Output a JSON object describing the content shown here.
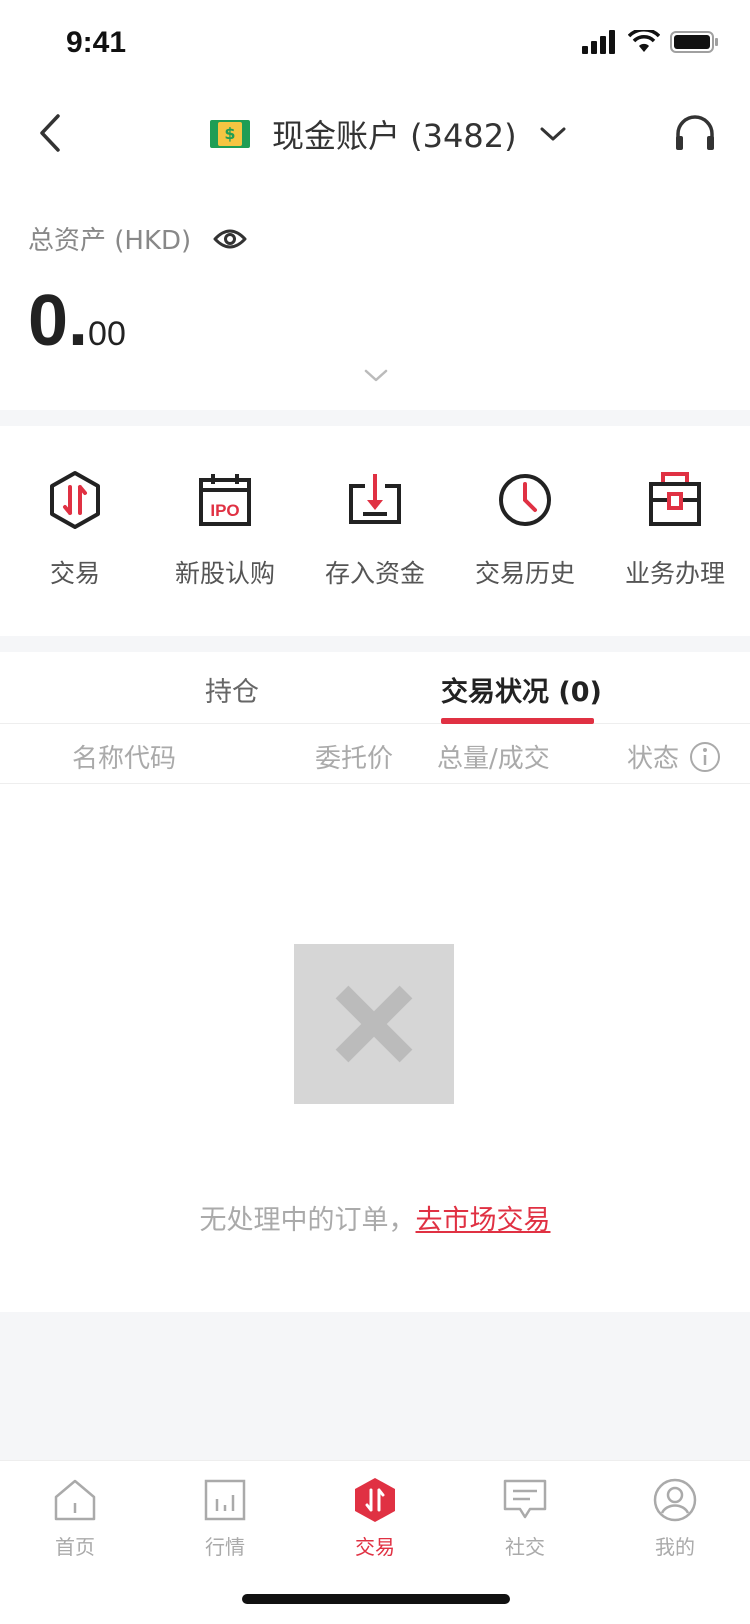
{
  "status": {
    "time": "9:41"
  },
  "nav": {
    "account_label": "现金账户 (3482)"
  },
  "assets": {
    "label": "总资产 (HKD)",
    "value_int": "0.",
    "value_dec": "00"
  },
  "quick_actions": [
    {
      "label": "交易",
      "icon": "trade-hexagon-icon"
    },
    {
      "label": "新股认购",
      "icon": "ipo-calendar-icon"
    },
    {
      "label": "存入资金",
      "icon": "deposit-icon"
    },
    {
      "label": "交易历史",
      "icon": "clock-icon"
    },
    {
      "label": "业务办理",
      "icon": "briefcase-icon"
    }
  ],
  "tabs": {
    "holdings": "持仓",
    "orders": "交易状况 (0)"
  },
  "table_header": {
    "name": "名称代码",
    "price": "委托价",
    "qty": "总量/成交",
    "status": "状态"
  },
  "empty": {
    "text": "无处理中的订单，",
    "link": "去市场交易"
  },
  "tab_bar": [
    {
      "label": "首页",
      "icon": "home-icon"
    },
    {
      "label": "行情",
      "icon": "market-chart-icon"
    },
    {
      "label": "交易",
      "icon": "trade-hexagon-icon",
      "active": true
    },
    {
      "label": "社交",
      "icon": "chat-icon"
    },
    {
      "label": "我的",
      "icon": "profile-icon"
    }
  ],
  "colors": {
    "accent": "#e03143",
    "muted": "#aaaaaa",
    "band": "#f5f6f8"
  }
}
